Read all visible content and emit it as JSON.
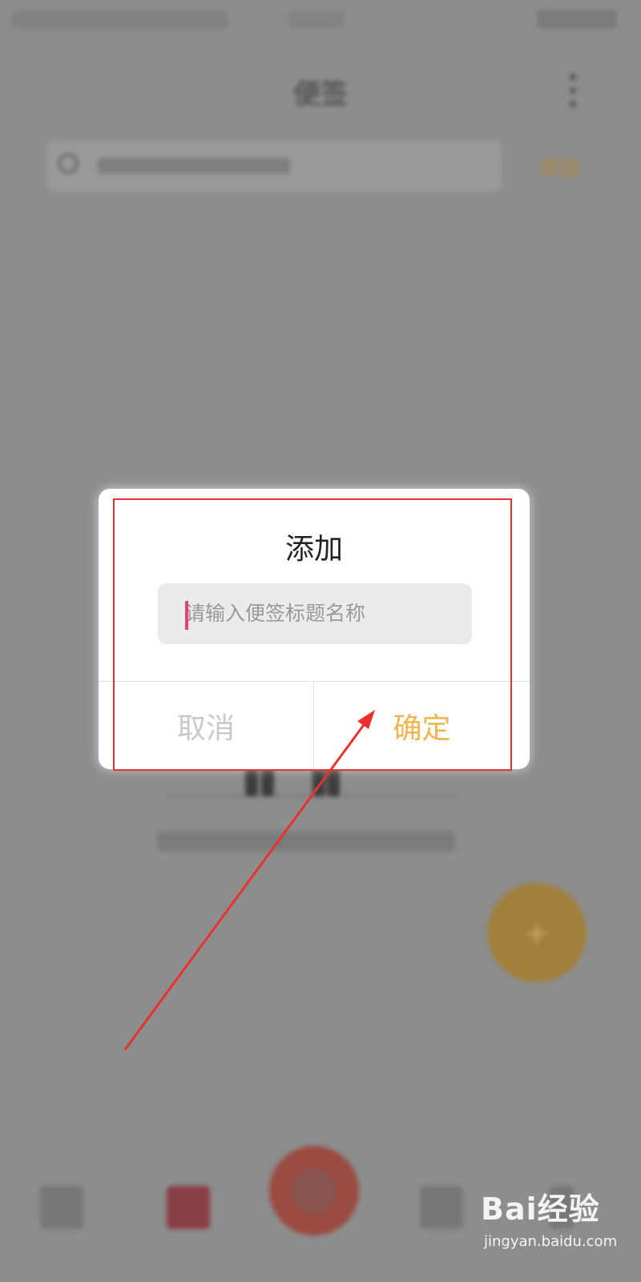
{
  "app": {
    "title": "便签",
    "search": {
      "button_label": "添加"
    },
    "fab_symbol": "+"
  },
  "dialog": {
    "title": "添加",
    "input": {
      "placeholder": "请输入便签标题名称",
      "value": ""
    },
    "cancel_label": "取消",
    "confirm_label": "确定"
  },
  "watermark": {
    "brand": "Bai经验",
    "url": "jingyan.baidu.com"
  },
  "colors": {
    "confirm": "#f0b450",
    "cancel": "#c9c9c9",
    "annotation": "#e8322e",
    "cursor": "#e2446e"
  },
  "icons": {
    "menu": "kebab-icon",
    "search": "search-icon"
  }
}
